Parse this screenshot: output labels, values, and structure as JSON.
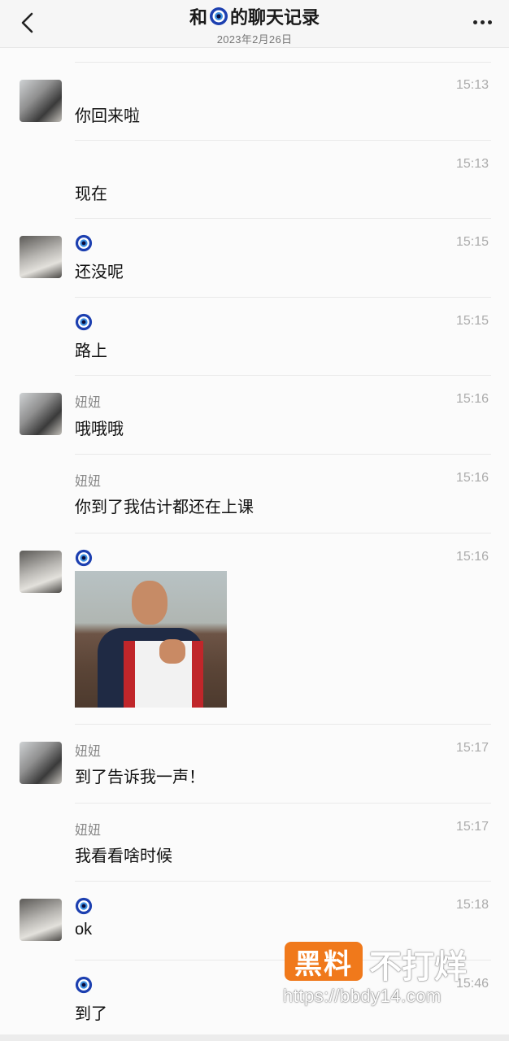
{
  "header": {
    "title_prefix": "和",
    "title_suffix": "的聊天记录",
    "date": "2023年2月26日"
  },
  "messages": [
    {
      "avatar": "a",
      "sender": "",
      "sender_icon": false,
      "time": "15:13",
      "text": "你回来啦"
    },
    {
      "avatar": "",
      "sender": "",
      "sender_icon": false,
      "time": "15:13",
      "text": "现在"
    },
    {
      "avatar": "b",
      "sender": "",
      "sender_icon": true,
      "time": "15:15",
      "text": "还没呢"
    },
    {
      "avatar": "",
      "sender": "",
      "sender_icon": true,
      "time": "15:15",
      "text": "路上"
    },
    {
      "avatar": "a",
      "sender": "妞妞",
      "sender_icon": false,
      "time": "15:16",
      "text": "哦哦哦"
    },
    {
      "avatar": "",
      "sender": "妞妞",
      "sender_icon": false,
      "time": "15:16",
      "text": "你到了我估计都还在上课"
    },
    {
      "avatar": "b",
      "sender": "",
      "sender_icon": true,
      "time": "15:16",
      "text": "",
      "sticker": true
    },
    {
      "avatar": "a",
      "sender": "妞妞",
      "sender_icon": false,
      "time": "15:17",
      "text": "到了告诉我一声！"
    },
    {
      "avatar": "",
      "sender": "妞妞",
      "sender_icon": false,
      "time": "15:17",
      "text": "我看看啥时候"
    },
    {
      "avatar": "b",
      "sender": "",
      "sender_icon": true,
      "time": "15:18",
      "text": "ok"
    },
    {
      "avatar": "",
      "sender": "",
      "sender_icon": true,
      "time": "15:46",
      "text": "到了"
    }
  ],
  "watermark": {
    "logo": "黑料",
    "text": "不打烊",
    "url": "https://bbdy14.com"
  },
  "colors": {
    "header_bg": "#f6f6f6",
    "eye_outer": "#1c3fb0",
    "watermark_logo": "#f0791b"
  },
  "icons": {
    "back": "chevron-left-icon",
    "more": "more-dots-icon",
    "sender": "nazar-eye-icon"
  }
}
